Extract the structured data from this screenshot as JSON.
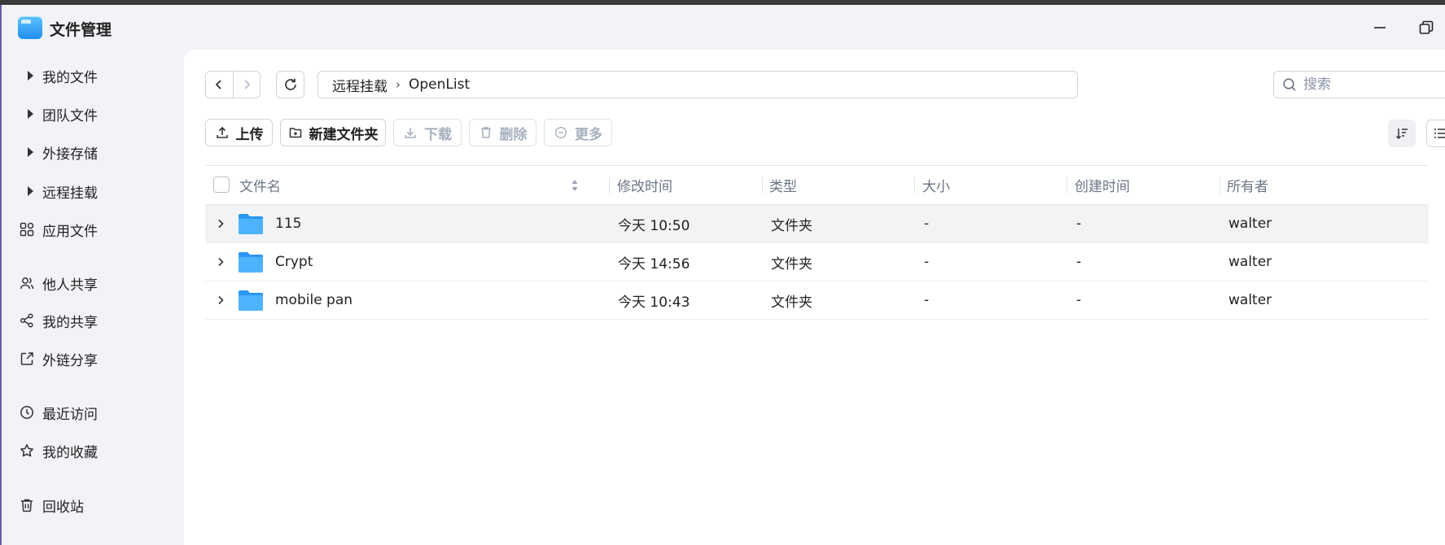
{
  "app": {
    "title": "文件管理",
    "icon": "folder-app-icon",
    "accent": "#1f8ef1"
  },
  "window_controls": {
    "minimize_icon": "minimize-icon",
    "restore_icon": "restore-icon"
  },
  "sidebar": {
    "items": [
      {
        "label": "我的文件",
        "icon": "caret-right-icon"
      },
      {
        "label": "团队文件",
        "icon": "caret-right-icon"
      },
      {
        "label": "外接存储",
        "icon": "caret-right-icon"
      },
      {
        "label": "远程挂载",
        "icon": "caret-right-icon"
      },
      {
        "label": "应用文件",
        "icon": "apps-grid-icon"
      },
      {
        "label": "他人共享",
        "icon": "users-icon"
      },
      {
        "label": "我的共享",
        "icon": "share-icon"
      },
      {
        "label": "外链分享",
        "icon": "external-link-icon"
      },
      {
        "label": "最近访问",
        "icon": "clock-icon"
      },
      {
        "label": "我的收藏",
        "icon": "star-icon"
      },
      {
        "label": "回收站",
        "icon": "trash-icon"
      }
    ]
  },
  "breadcrumb": {
    "segments": [
      "远程挂载",
      "OpenList"
    ]
  },
  "search": {
    "placeholder": "搜索",
    "value": ""
  },
  "toolbar": {
    "upload": "上传",
    "new_folder": "新建文件夹",
    "download": "下载",
    "delete": "删除",
    "more": "更多"
  },
  "table": {
    "columns": [
      "文件名",
      "修改时间",
      "类型",
      "大小",
      "创建时间",
      "所有者"
    ],
    "rows": [
      {
        "name": "115",
        "modified": "今天 10:50",
        "type": "文件夹",
        "size": "-",
        "created": "-",
        "owner": "walter"
      },
      {
        "name": "Crypt",
        "modified": "今天 14:56",
        "type": "文件夹",
        "size": "-",
        "created": "-",
        "owner": "walter"
      },
      {
        "name": "mobile pan",
        "modified": "今天 10:43",
        "type": "文件夹",
        "size": "-",
        "created": "-",
        "owner": "walter"
      }
    ]
  }
}
